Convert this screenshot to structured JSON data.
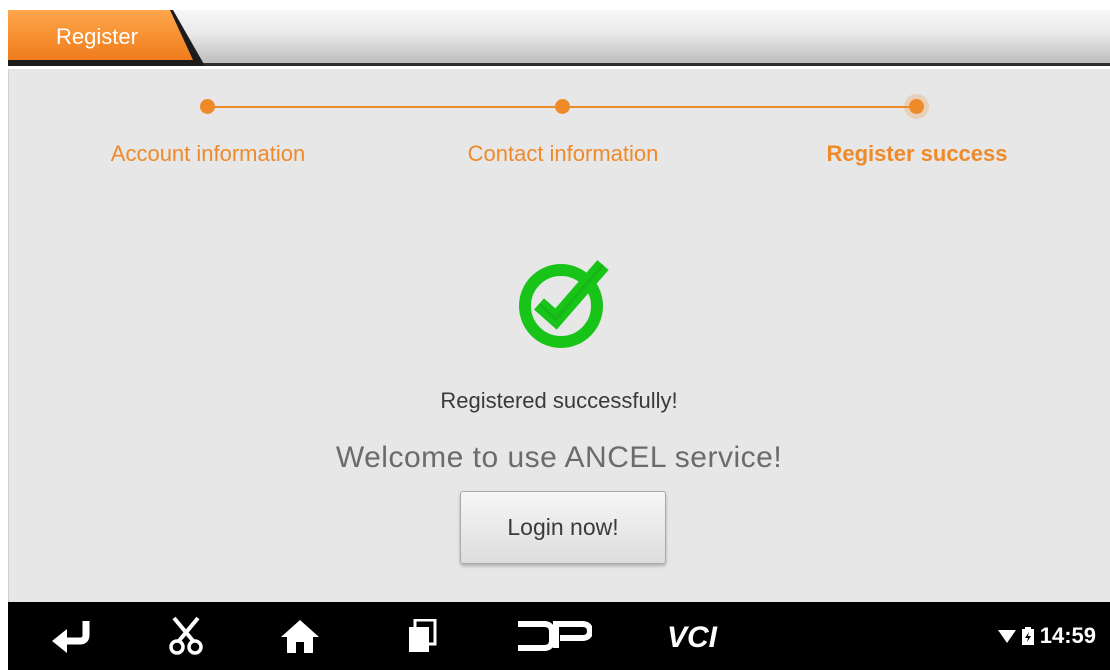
{
  "tab": {
    "title": "Register"
  },
  "steps": [
    {
      "label": "Account information",
      "state": "done"
    },
    {
      "label": "Contact information",
      "state": "done"
    },
    {
      "label": "Register success",
      "state": "active"
    }
  ],
  "result": {
    "title": "Registered successfully!",
    "welcome": "Welcome to use ANCEL service!",
    "login_button": "Login now!"
  },
  "navbar": {
    "items": [
      {
        "icon": "back-icon"
      },
      {
        "icon": "scissors-icon"
      },
      {
        "icon": "home-icon"
      },
      {
        "icon": "recent-apps-icon"
      },
      {
        "icon": "dp-icon"
      },
      {
        "icon": "vci-icon"
      }
    ],
    "status": {
      "time": "14:59"
    }
  },
  "colors": {
    "accent": "#ef8a2b",
    "success": "#19c419",
    "panel": "#e7e7e7",
    "navbar": "#000000"
  }
}
